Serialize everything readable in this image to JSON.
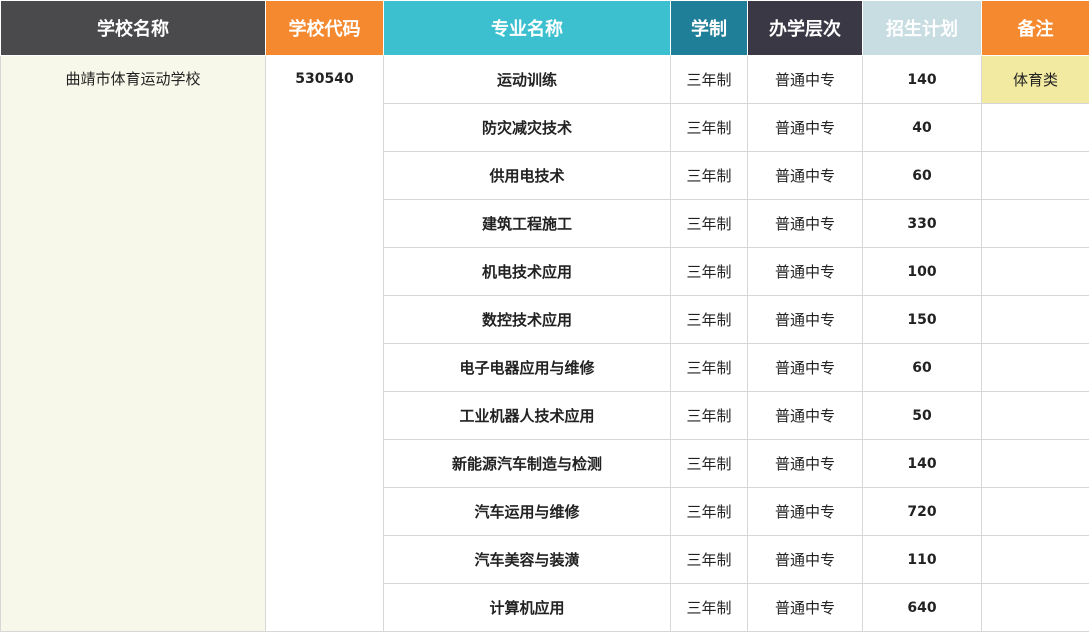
{
  "colors": {
    "school_header": "#4a4a4c",
    "code_header": "#f5892f",
    "major_header": "#3cc0cf",
    "duration_header": "#1f7f99",
    "level_header": "#3a3845",
    "plan_header": "#c8dde2",
    "remark_header": "#f5892f",
    "school_cell_bg": "#f8f8ea",
    "remark_cell_bg": "#f3eaa2"
  },
  "headers": {
    "school": "学校名称",
    "code": "学校代码",
    "major": "专业名称",
    "duration": "学制",
    "level": "办学层次",
    "plan": "招生计划",
    "remark": "备注"
  },
  "school": {
    "name": "曲靖市体育运动学校",
    "code": "530540",
    "remark": "体育类"
  },
  "rows": [
    {
      "major": "运动训练",
      "duration": "三年制",
      "level": "普通中专",
      "plan": "140"
    },
    {
      "major": "防灾减灾技术",
      "duration": "三年制",
      "level": "普通中专",
      "plan": "40"
    },
    {
      "major": "供用电技术",
      "duration": "三年制",
      "level": "普通中专",
      "plan": "60"
    },
    {
      "major": "建筑工程施工",
      "duration": "三年制",
      "level": "普通中专",
      "plan": "330"
    },
    {
      "major": "机电技术应用",
      "duration": "三年制",
      "level": "普通中专",
      "plan": "100"
    },
    {
      "major": "数控技术应用",
      "duration": "三年制",
      "level": "普通中专",
      "plan": "150"
    },
    {
      "major": "电子电器应用与维修",
      "duration": "三年制",
      "level": "普通中专",
      "plan": "60"
    },
    {
      "major": "工业机器人技术应用",
      "duration": "三年制",
      "level": "普通中专",
      "plan": "50"
    },
    {
      "major": "新能源汽车制造与检测",
      "duration": "三年制",
      "level": "普通中专",
      "plan": "140"
    },
    {
      "major": "汽车运用与维修",
      "duration": "三年制",
      "level": "普通中专",
      "plan": "720"
    },
    {
      "major": "汽车美容与装潢",
      "duration": "三年制",
      "level": "普通中专",
      "plan": "110"
    },
    {
      "major": "计算机应用",
      "duration": "三年制",
      "level": "普通中专",
      "plan": "640"
    }
  ]
}
